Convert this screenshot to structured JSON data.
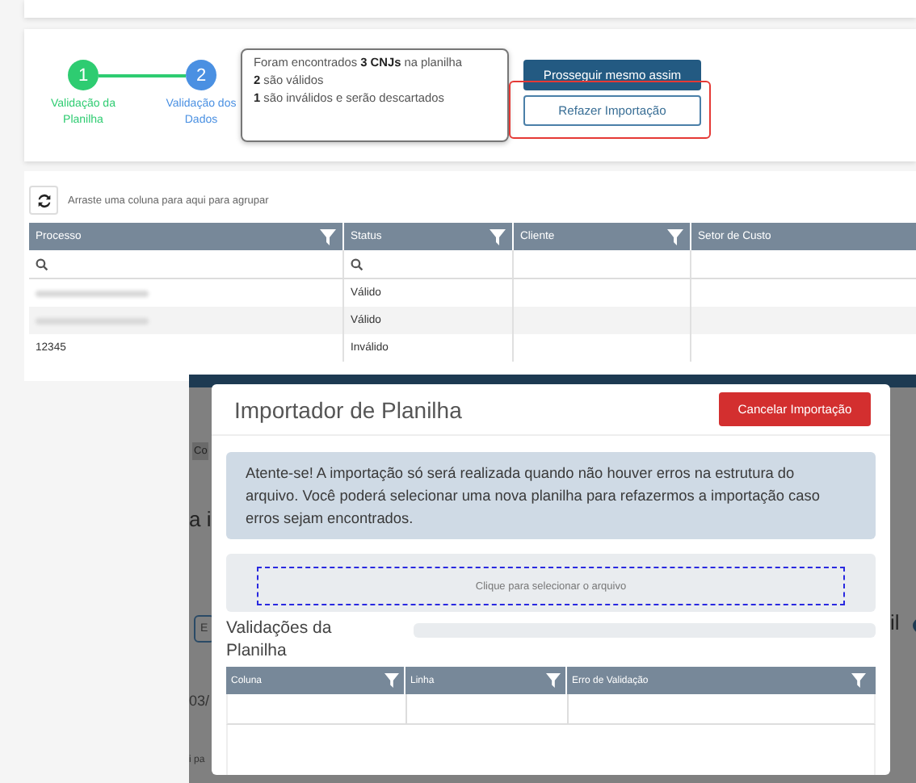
{
  "stepper": {
    "steps": [
      {
        "number": "1",
        "label": "Validação da Planilha",
        "done": true
      },
      {
        "number": "2",
        "label": "Validação dos Dados",
        "done": false
      }
    ]
  },
  "summary": {
    "lines": [
      "Foram encontrados **3 CNJs** na planilha",
      "**2** são válidos",
      "**1** são inválidos e serão descartados"
    ]
  },
  "actions": [
    {
      "label": "Prosseguir mesmo assim",
      "kind": "primary",
      "highlighted": false
    },
    {
      "label": "Refazer Importação",
      "kind": "outline",
      "highlighted": true
    }
  ],
  "grid": {
    "group_hint": "Arraste uma coluna para aqui para agrupar",
    "columns": [
      {
        "label": "Processo",
        "filter": true,
        "search": true
      },
      {
        "label": "Status",
        "filter": true,
        "search": true
      },
      {
        "label": "Cliente",
        "filter": true,
        "search": false
      },
      {
        "label": "Setor de Custo",
        "filter": false,
        "search": false
      }
    ],
    "rows": [
      {
        "process_redacted": true,
        "status": "Válido"
      },
      {
        "process_redacted": true,
        "status": "Válido"
      },
      {
        "process": "12345",
        "status": "Inválido"
      }
    ]
  },
  "background_fragments": [
    "Co",
    "a i",
    "E",
    "03/",
    "i pa",
    "il"
  ],
  "modal": {
    "title": "Importador de Planilha",
    "cancel_button": "Cancelar Importação",
    "alert": "Atente-se! A importação só será realizada quando não houver erros na estrutura do arquivo. Você poderá selecionar uma nova planilha para refazermos a importação caso erros sejam encontrados.",
    "dropzone": "Clique para selecionar o arquivo",
    "validations": {
      "title": "Validações da Planilha",
      "columns": [
        {
          "label": "Coluna",
          "filter": true
        },
        {
          "label": "Linha",
          "filter": true
        },
        {
          "label": "Erro de Validação",
          "filter": true
        }
      ]
    }
  }
}
